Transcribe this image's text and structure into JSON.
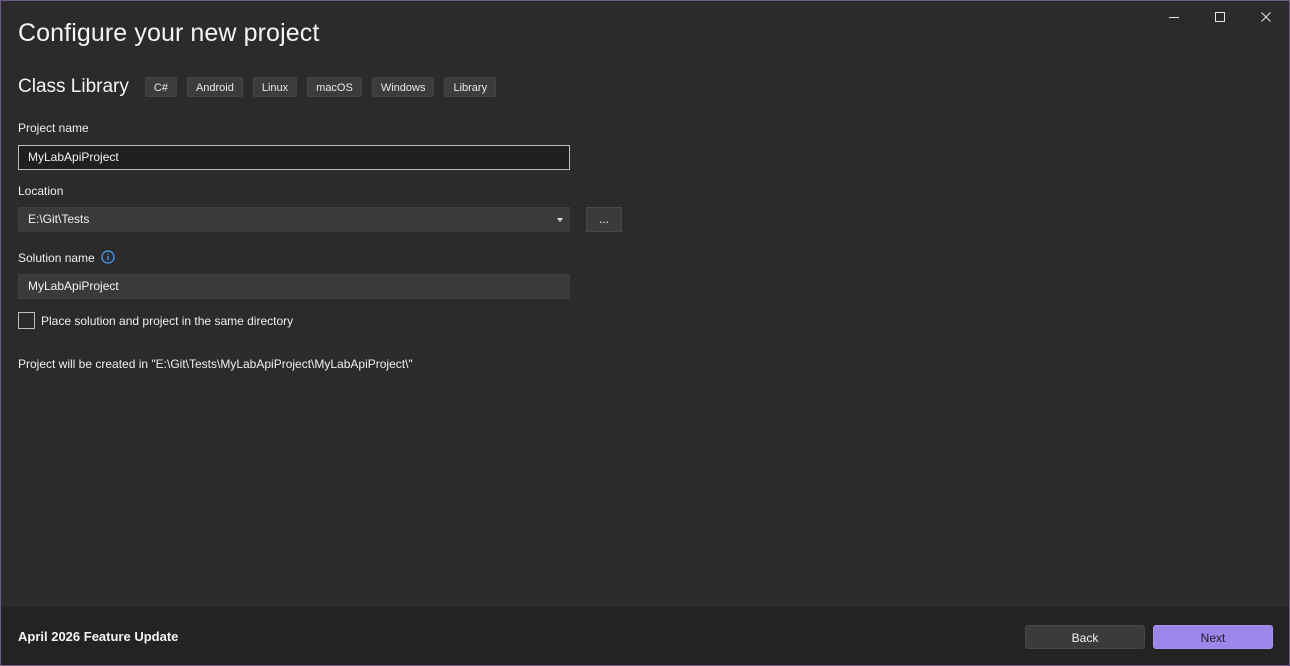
{
  "page": {
    "title": "Configure your new project"
  },
  "template": {
    "name": "Class Library",
    "tags": [
      "C#",
      "Android",
      "Linux",
      "macOS",
      "Windows",
      "Library"
    ]
  },
  "fields": {
    "project_name_label": "Project name",
    "project_name_value": "MyLabApiProject",
    "location_label": "Location",
    "location_value": "E:\\Git\\Tests",
    "browse_label": "...",
    "solution_name_label": "Solution name",
    "solution_name_value": "MyLabApiProject",
    "same_directory_label": "Place solution and project in the same directory",
    "same_directory_checked": false,
    "path_note": "Project will be created in \"E:\\Git\\Tests\\MyLabApiProject\\MyLabApiProject\\\""
  },
  "footer": {
    "update_label": "April 2026 Feature Update",
    "back_label": "Back",
    "next_label": "Next"
  },
  "colors": {
    "background": "#2b2b2b",
    "accent": "#9b87ea",
    "footer": "#232323",
    "info_icon": "#4aa3ff"
  }
}
